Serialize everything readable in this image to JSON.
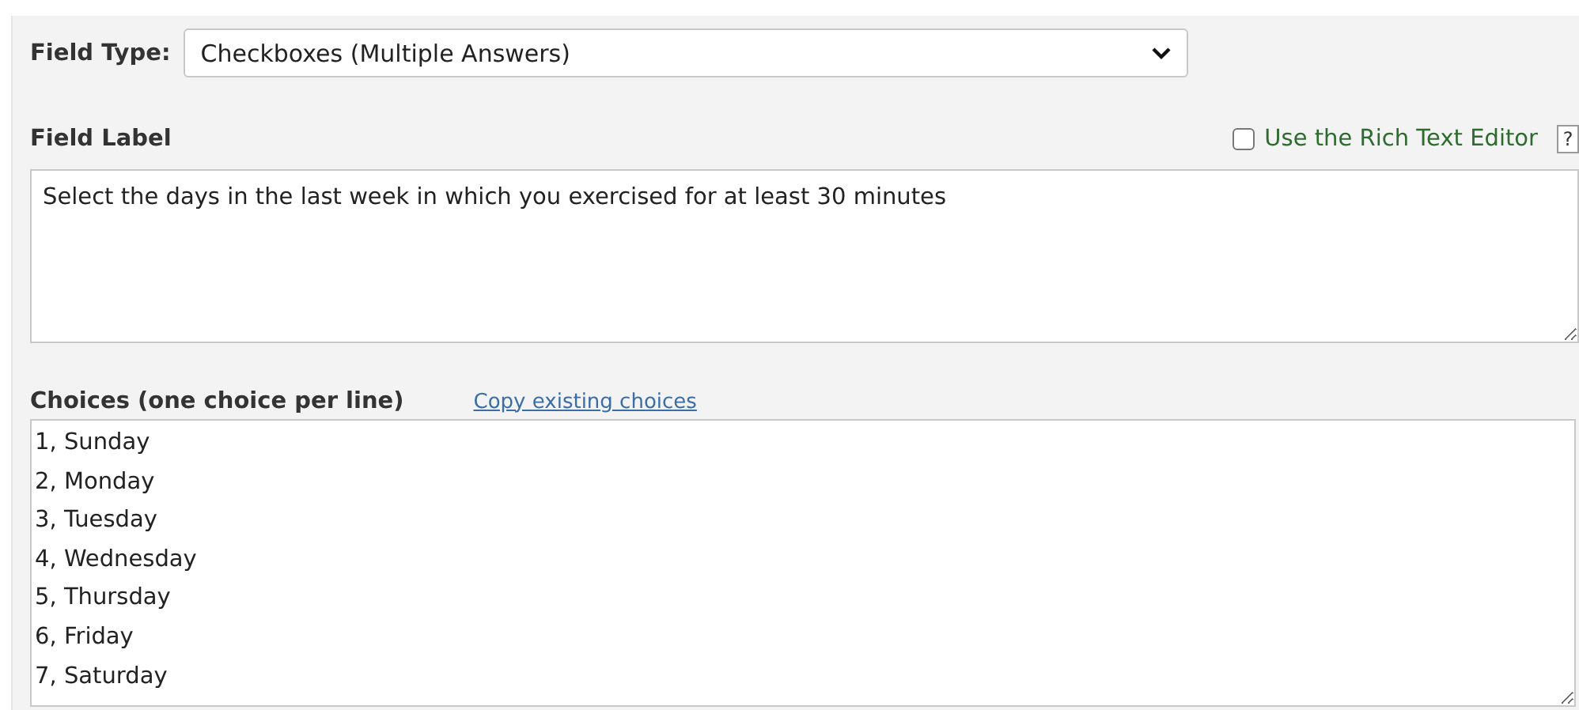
{
  "field_type": {
    "label": "Field Type:",
    "value": "Checkboxes (Multiple Answers)"
  },
  "field_label": {
    "heading": "Field Label",
    "rich_text_editor": {
      "label": "Use the Rich Text Editor",
      "checked": false
    },
    "help": "?",
    "value": "Select the days in the last week in which you exercised for at least 30 minutes"
  },
  "choices": {
    "heading": "Choices (one choice per line)",
    "link": "Copy existing choices",
    "lines": [
      "1, Sunday",
      "2, Monday",
      "3, Tuesday",
      "4, Wednesday",
      "5, Thursday",
      "6, Friday",
      "7, Saturday"
    ]
  }
}
